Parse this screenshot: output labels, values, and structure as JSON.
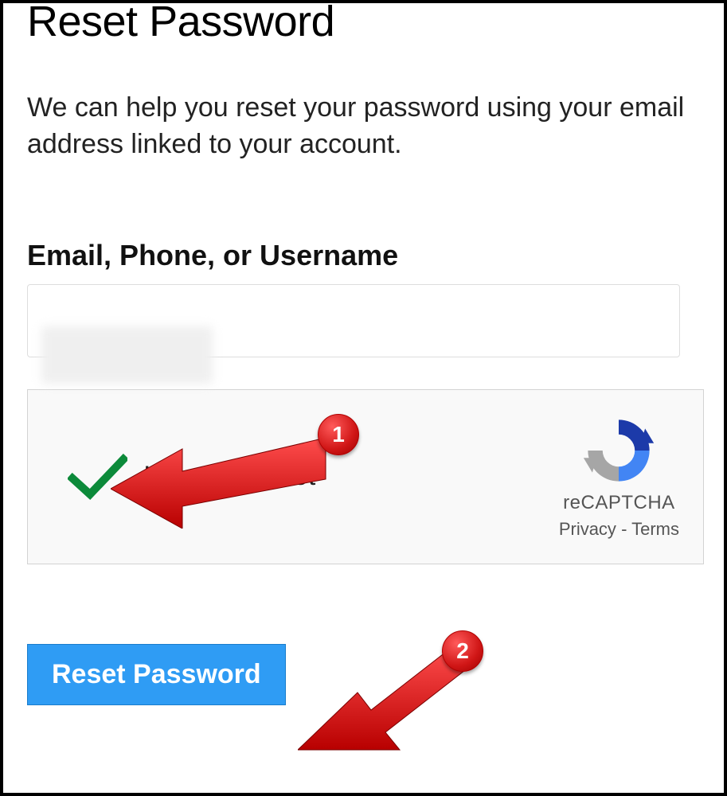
{
  "heading": "Reset Password",
  "description": "We can help you reset your password using your email address linked to your account.",
  "form": {
    "identifier_label": "Email, Phone, or Username",
    "identifier_value": ""
  },
  "recaptcha": {
    "label": "I'm not a robot",
    "brand": "reCAPTCHA",
    "privacy": "Privacy",
    "terms": "Terms",
    "checked": true
  },
  "button": {
    "label": "Reset Password"
  },
  "annotations": [
    {
      "number": "1"
    },
    {
      "number": "2"
    }
  ]
}
